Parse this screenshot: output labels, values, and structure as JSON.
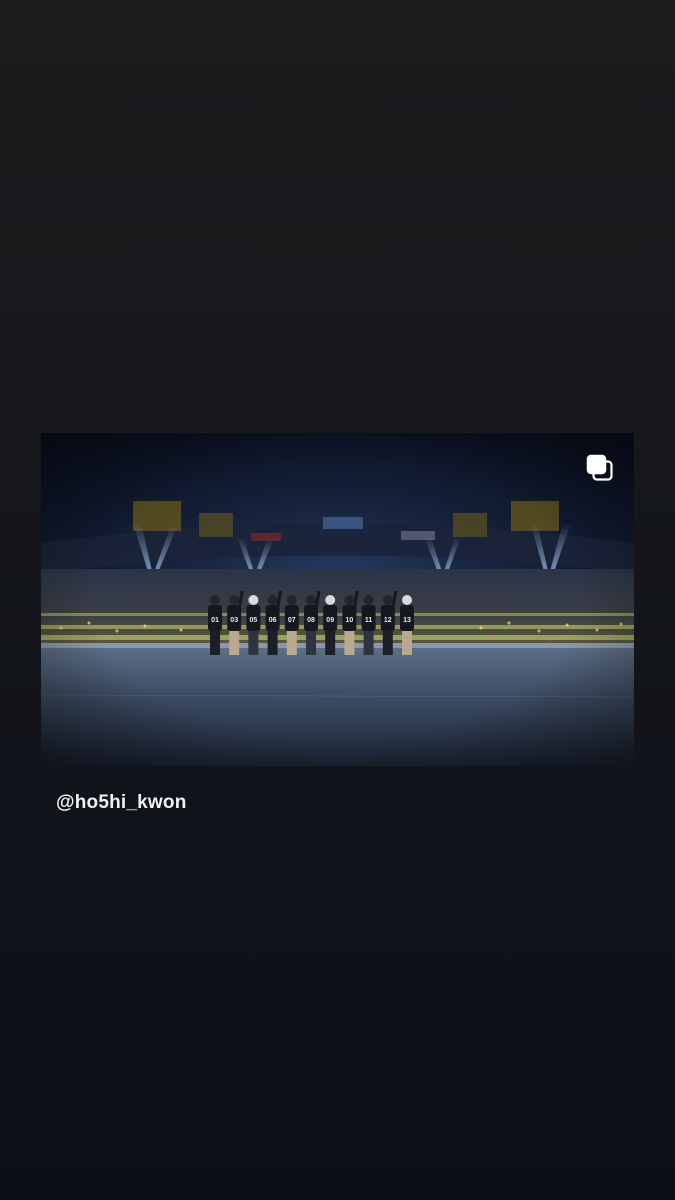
{
  "story": {
    "username": "@ho5hi_kwon",
    "shared_post": {
      "icons": {
        "carousel": "multiple-photos-icon"
      },
      "jersey_numbers": [
        "01",
        "03",
        "05",
        "06",
        "07",
        "08",
        "09",
        "10",
        "11",
        "12",
        "13"
      ]
    }
  }
}
